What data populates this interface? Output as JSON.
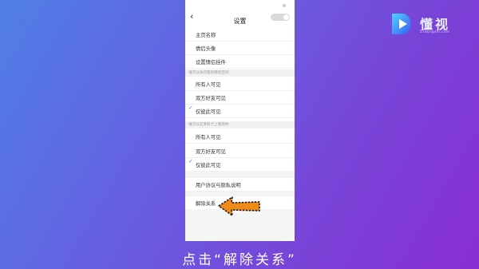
{
  "header": {
    "back": "‹",
    "title": "设置"
  },
  "rows": {
    "homepage_name": "主页名称",
    "couple_avatar": "情侣头像",
    "couple_widget": "设置情侣挂件"
  },
  "section1": {
    "title": "谁可以访问我的情侣空间",
    "options": [
      "所有人可见",
      "双方好友可见",
      "仅彼此可见"
    ]
  },
  "section2": {
    "title": "谁可以在资料卡上看到你",
    "options": [
      "所有人可见",
      "双方好友可见",
      "仅彼此可见"
    ]
  },
  "agreement": "用户协议与隐私说明",
  "unbind": "解除关系",
  "caption": "点击“解除关系”",
  "logo": {
    "name": "懂视",
    "sub": "51dongshi.com"
  },
  "colors": {
    "accent": "#3a8ee6",
    "arrow": "#f08a18"
  },
  "icons": [
    "back-chevron-icon",
    "check-icon",
    "arrow-icon",
    "brand-logo-icon"
  ]
}
